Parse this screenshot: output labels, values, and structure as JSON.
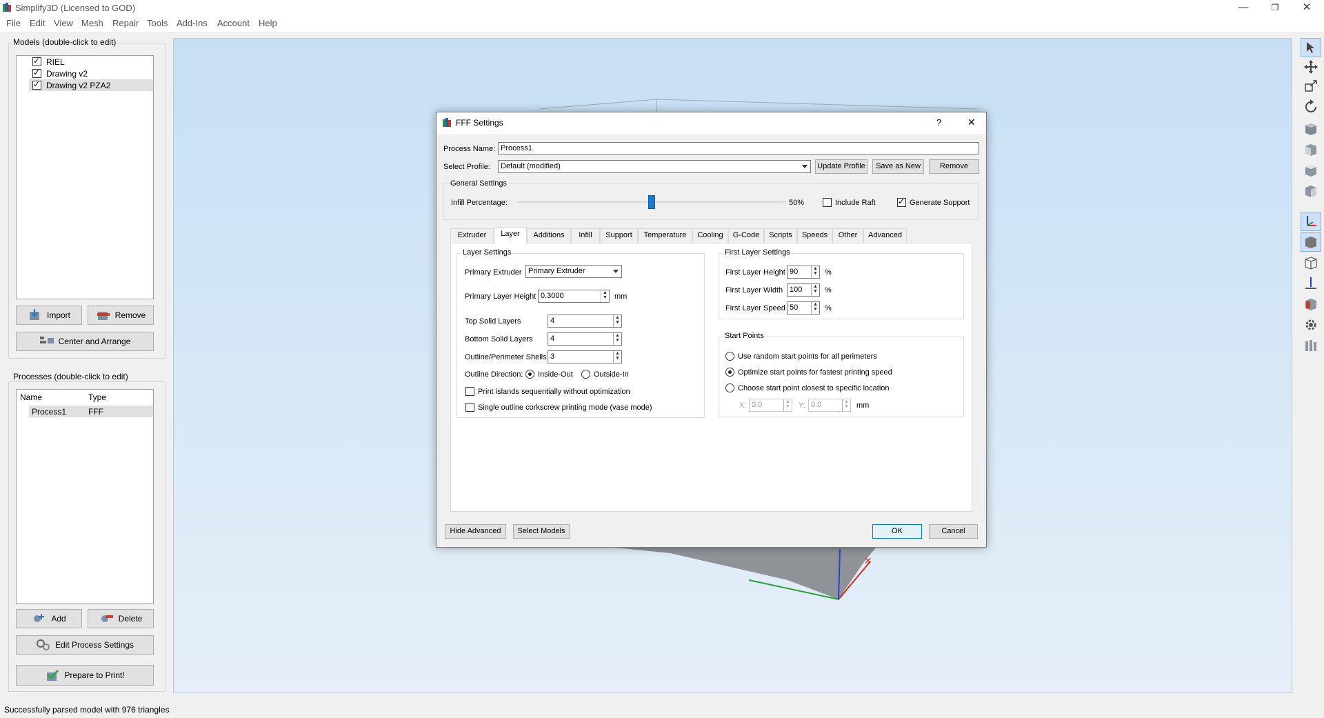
{
  "window": {
    "title": "Simplify3D (Licensed to GOD)",
    "minimize": "—",
    "restore": "❐",
    "close": "✕"
  },
  "menu": [
    "File",
    "Edit",
    "View",
    "Mesh",
    "Repair",
    "Tools",
    "Add-Ins",
    "Account",
    "Help"
  ],
  "models_panel": {
    "label": "Models (double-click to edit)",
    "items": [
      {
        "name": "RIEL",
        "checked": true,
        "selected": false
      },
      {
        "name": "Drawing v2",
        "checked": true,
        "selected": false
      },
      {
        "name": "Drawing v2 PZA2",
        "checked": true,
        "selected": true
      }
    ],
    "import_label": "Import",
    "remove_label": "Remove",
    "center_label": "Center and Arrange"
  },
  "processes_panel": {
    "label": "Processes (double-click to edit)",
    "col_name": "Name",
    "col_type": "Type",
    "rows": [
      {
        "name": "Process1",
        "type": "FFF"
      }
    ],
    "add_label": "Add",
    "delete_label": "Delete",
    "edit_label": "Edit Process Settings",
    "prepare_label": "Prepare to Print!"
  },
  "status": "Successfully parsed model with 976 triangles",
  "dialog": {
    "title": "FFF Settings",
    "help": "?",
    "close": "✕",
    "process_name_label": "Process Name:",
    "process_name_value": "Process1",
    "select_profile_label": "Select Profile:",
    "select_profile_value": "Default (modified)",
    "update_profile": "Update Profile",
    "save_as_new": "Save as New",
    "remove": "Remove",
    "general_settings": "General Settings",
    "infill_label": "Infill Percentage:",
    "infill_value": "50%",
    "infill_fraction": 0.5,
    "include_raft": "Include Raft",
    "include_raft_checked": false,
    "generate_support": "Generate Support",
    "generate_support_checked": true,
    "tabs": [
      "Extruder",
      "Layer",
      "Additions",
      "Infill",
      "Support",
      "Temperature",
      "Cooling",
      "G-Code",
      "Scripts",
      "Speeds",
      "Other",
      "Advanced"
    ],
    "active_tab": "Layer",
    "layer_settings": {
      "title": "Layer Settings",
      "primary_extruder_label": "Primary Extruder",
      "primary_extruder_value": "Primary Extruder",
      "primary_layer_height_label": "Primary Layer Height",
      "primary_layer_height_value": "0.3000",
      "primary_layer_height_unit": "mm",
      "top_solid_label": "Top Solid Layers",
      "top_solid_value": "4",
      "bottom_solid_label": "Bottom Solid Layers",
      "bottom_solid_value": "4",
      "outline_shells_label": "Outline/Perimeter Shells",
      "outline_shells_value": "3",
      "outline_direction_label": "Outline Direction:",
      "inside_out": "Inside-Out",
      "outside_in": "Outside-In",
      "print_islands": "Print islands sequentially without optimization",
      "vase_mode": "Single outline corkscrew printing mode (vase mode)"
    },
    "first_layer": {
      "title": "First Layer Settings",
      "height_label": "First Layer Height",
      "height_value": "90",
      "width_label": "First Layer Width",
      "width_value": "100",
      "speed_label": "First Layer Speed",
      "speed_value": "50",
      "unit": "%"
    },
    "start_points": {
      "title": "Start Points",
      "opt_random": "Use random start points for all perimeters",
      "opt_optimize": "Optimize start points for fastest printing speed",
      "opt_closest": "Choose start point closest to specific location",
      "x_label": "X:",
      "x_value": "0.0",
      "y_label": "Y:",
      "y_value": "0.0",
      "unit": "mm"
    },
    "hide_advanced": "Hide Advanced",
    "select_models": "Select Models",
    "ok": "OK",
    "cancel": "Cancel"
  }
}
